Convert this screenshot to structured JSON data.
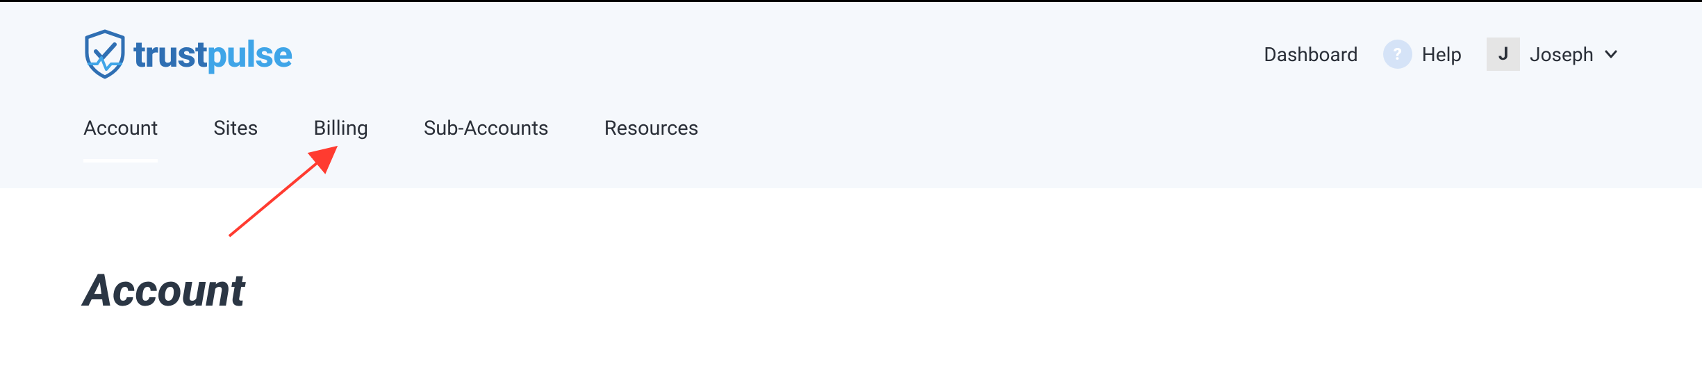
{
  "brand": {
    "part1": "trust",
    "part2": "pulse"
  },
  "header": {
    "dashboard_label": "Dashboard",
    "help_label": "Help",
    "user_initial": "J",
    "user_name": "Joseph"
  },
  "tabs": {
    "account": "Account",
    "sites": "Sites",
    "billing": "Billing",
    "subaccounts": "Sub-Accounts",
    "resources": "Resources"
  },
  "page": {
    "title": "Account"
  }
}
